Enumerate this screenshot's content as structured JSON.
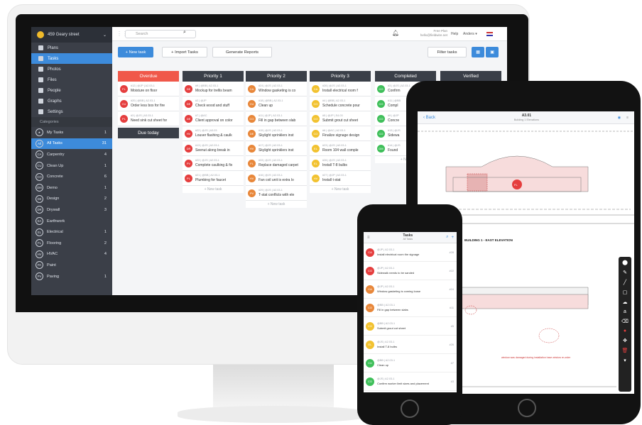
{
  "sidebar": {
    "location": "459 Geary street",
    "nav": [
      {
        "label": "Plans"
      },
      {
        "label": "Tasks"
      },
      {
        "label": "Photos"
      },
      {
        "label": "Files"
      },
      {
        "label": "People"
      },
      {
        "label": "Graphs"
      },
      {
        "label": "Settings"
      }
    ],
    "categories_title": "Categories",
    "categories": [
      {
        "badge": "★",
        "label": "My Tasks",
        "count": "1"
      },
      {
        "badge": "All",
        "label": "All Tasks",
        "count": "31"
      },
      {
        "badge": "CA",
        "label": "Carpentry",
        "count": "4"
      },
      {
        "badge": "CU",
        "label": "Clean Up",
        "count": "1"
      },
      {
        "badge": "CO",
        "label": "Concrete",
        "count": "6"
      },
      {
        "badge": "DM",
        "label": "Demo",
        "count": "1"
      },
      {
        "badge": "DE",
        "label": "Design",
        "count": "2"
      },
      {
        "badge": "DR",
        "label": "Drywall",
        "count": "3"
      },
      {
        "badge": "EA",
        "label": "Earthwork",
        "count": ""
      },
      {
        "badge": "EL",
        "label": "Electrical",
        "count": "1"
      },
      {
        "badge": "FL",
        "label": "Flooring",
        "count": "2"
      },
      {
        "badge": "HV",
        "label": "HVAC",
        "count": "4"
      },
      {
        "badge": "PA",
        "label": "Paint",
        "count": ""
      },
      {
        "badge": "PV",
        "label": "Paving",
        "count": "1"
      }
    ]
  },
  "topbar": {
    "search_placeholder": "Search",
    "plan": "Free Plan",
    "email": "hello@fieldwire.net",
    "help": "Help",
    "user": "Anders ▾"
  },
  "toolbar": {
    "new_task": "+ New task",
    "import": "+ Import Tasks",
    "reports": "Generate Reports",
    "filter": "Filter tasks"
  },
  "columns": [
    {
      "title": "Overdue",
      "color": "#f0584a",
      "cards": [
        {
          "pin": "FL",
          "color": "#e53e3e",
          "meta": "#12 | @JP | A2.03-1",
          "name": "Moisture on floor"
        },
        {
          "pin": "CU",
          "color": "#e53e3e",
          "meta": "#20 | @BB | A2.03-1",
          "name": "Order less box for fire"
        },
        {
          "pin": "PL",
          "color": "#e53e3e",
          "meta": "#3 | @JS | A3.03-1",
          "name": "Need sink cut sheet for"
        }
      ],
      "subtitle": "Due today"
    },
    {
      "title": "Priority 1",
      "color": "#3a3f48",
      "cards": [
        {
          "pin": "DE",
          "color": "#e53e3e",
          "meta": "#9 | @BB | A2.03-1",
          "name": "Mockup for trellis beam"
        },
        {
          "pin": "DE",
          "color": "#e53e3e",
          "meta": "#2 | @JP",
          "name": "Check wood and stuff"
        },
        {
          "pin": "DE",
          "color": "#e53e3e",
          "meta": "#7 | @AC",
          "name": "Client approval on color"
        },
        {
          "pin": "HV",
          "color": "#e53e3e",
          "meta": "#22 | @JS | A3.03",
          "name": "Louver flashing & caulk"
        },
        {
          "pin": "DR",
          "color": "#e53e3e",
          "meta": "#13 | @JS | A2.03-1",
          "name": "Seenut along break in"
        },
        {
          "pin": "PV",
          "color": "#e53e3e",
          "meta": "#22 | @JS | A2.03-1",
          "name": "Complete caulking & fix"
        },
        {
          "pin": "PL",
          "color": "#e53e3e",
          "meta": "#21 | @BB | A2.03-1",
          "name": "Plumbing for faucet"
        }
      ],
      "new": "+ New task"
    },
    {
      "title": "Priority 2",
      "color": "#3a3f48",
      "cards": [
        {
          "pin": "CA",
          "color": "#e8873a",
          "meta": "#24 | @JS | A2.03-1",
          "name": "Window gasketing is co"
        },
        {
          "pin": "CU",
          "color": "#e8873a",
          "meta": "#18 | @BB | A2.03-1",
          "name": "Clean up"
        },
        {
          "pin": "CO",
          "color": "#e8873a",
          "meta": "#11 | @JP | A2.03-1",
          "name": "Fill in gap between slab"
        },
        {
          "pin": "DE",
          "color": "#e8873a",
          "meta": "#15 | @JS | A2.03-1",
          "name": "Skylight sprinklers inst"
        },
        {
          "pin": "HV",
          "color": "#e8873a",
          "meta": "#17 | @JS | A2.03-1",
          "name": "Skylight sprinklers inst"
        },
        {
          "pin": "FL",
          "color": "#e8873a",
          "meta": "#33 | @JS | A2.03-1",
          "name": "Replace damaged carpet"
        },
        {
          "pin": "HV",
          "color": "#e8873a",
          "meta": "#16 | @JS | A2.03-1",
          "name": "Fan coil unit is extra lo"
        },
        {
          "pin": "PV",
          "color": "#e8873a",
          "meta": "#29 | @JS | A2.03-1",
          "name": "T-stat conflicts with ele"
        }
      ],
      "new": "+ New task"
    },
    {
      "title": "Priority 3",
      "color": "#3a3f48",
      "cards": [
        {
          "pin": "CA",
          "color": "#f2c230",
          "meta": "#26 | @JS | A2.03-1",
          "name": "Install electrical room f"
        },
        {
          "pin": "CO",
          "color": "#f2c230",
          "meta": "#4 | @BB | A2.03-1",
          "name": "Schedule concrete pour"
        },
        {
          "pin": "CO",
          "color": "#f2c230",
          "meta": "#5 | @JP | S4.03",
          "name": "Submit grout cut sheet"
        },
        {
          "pin": "CO",
          "color": "#f2c230",
          "meta": "#6 | @AC | A2.03-1",
          "name": "Finalize signage design"
        },
        {
          "pin": "EL",
          "color": "#f2c230",
          "meta": "#23 | @JS | A2.03-1",
          "name": "Room 104 wall comple"
        },
        {
          "pin": "EL",
          "color": "#f2c230",
          "meta": "#26 | @JS | A2.03-1",
          "name": "Install T-8 bulbs"
        },
        {
          "pin": "HV",
          "color": "#f2c230",
          "meta": "#27 | @JP | A2.03-1",
          "name": "Install t-stat"
        }
      ],
      "new": "+ New task"
    },
    {
      "title": "Completed",
      "color": "#3a3f48",
      "cards": [
        {
          "pin": "CO",
          "color": "#3fbf5a",
          "meta": "#3 | @JS | A2.03-1",
          "name": "Confirm"
        },
        {
          "pin": "CO",
          "color": "#3fbf5a",
          "meta": "#11 | @BB",
          "name": "Compl"
        },
        {
          "pin": "CO",
          "color": "#3fbf5a",
          "meta": "#9 | @JP",
          "name": "Concre"
        },
        {
          "pin": "CO",
          "color": "#3fbf5a",
          "meta": "#13 | @JS",
          "name": "Sidewa"
        },
        {
          "pin": "DM",
          "color": "#3fbf5a",
          "meta": "#14 | @JS",
          "name": "Found"
        }
      ],
      "new": "+ New"
    },
    {
      "title": "Verified",
      "color": "#3a3f48",
      "cards": []
    }
  ],
  "tablet": {
    "back": "Back",
    "sheet": "A3.01",
    "sheet_sub": "Building 1 Elevations",
    "elevation_label": "BUILDING 1 - EAST ELEVATION",
    "note_label": "window was damaged during installation have window re-order",
    "pin_label": "FL"
  },
  "phone": {
    "title": "Tasks",
    "subtitle": "All Tasks",
    "rows": [
      {
        "pin": "CA",
        "color": "#e53e3e",
        "meta": "@JP | A2.03-1",
        "num": "#28",
        "name": "Install electrical room the signage"
      },
      {
        "pin": "CO",
        "color": "#e53e3e",
        "meta": "@JP | A2.03-1",
        "num": "#22",
        "name": "Sidewalk needs to be sanded"
      },
      {
        "pin": "CA",
        "color": "#e8873a",
        "meta": "@JP | A2.03-1",
        "num": "#24",
        "name": "Window gasketing is coming loose"
      },
      {
        "pin": "CO",
        "color": "#e8873a",
        "meta": "@BB | A2.03-1",
        "num": "#11",
        "name": "Fill in gap between slabs"
      },
      {
        "pin": "CO",
        "color": "#f2c230",
        "meta": "@BB | A2.03-1",
        "num": "#5",
        "name": "Submit grout cut sheet"
      },
      {
        "pin": "EL",
        "color": "#f2c230",
        "meta": "@JS | A2.03-1",
        "num": "#26",
        "name": "Install T-8 bulbs"
      },
      {
        "pin": "CU",
        "color": "#3fbf5a",
        "meta": "@BB | A2.03-1",
        "num": "#7",
        "name": "Clean up"
      },
      {
        "pin": "CO",
        "color": "#3fbf5a",
        "meta": "@JS | A2.03-1",
        "num": "#3",
        "name": "Confirm worker limit sizes and placement"
      },
      {
        "pin": "DE",
        "color": "#3d8bdb",
        "meta": "@BB | A2.03-1",
        "num": "#2",
        "name": ""
      }
    ]
  },
  "colors": {
    "accent": "#3d8bdb",
    "overdue": "#f0584a",
    "sidebar": "#3b3f48"
  },
  "icons": [
    "home-icon",
    "bell-icon",
    "search-icon",
    "calendar-icon",
    "list-icon",
    "filter-icon"
  ]
}
